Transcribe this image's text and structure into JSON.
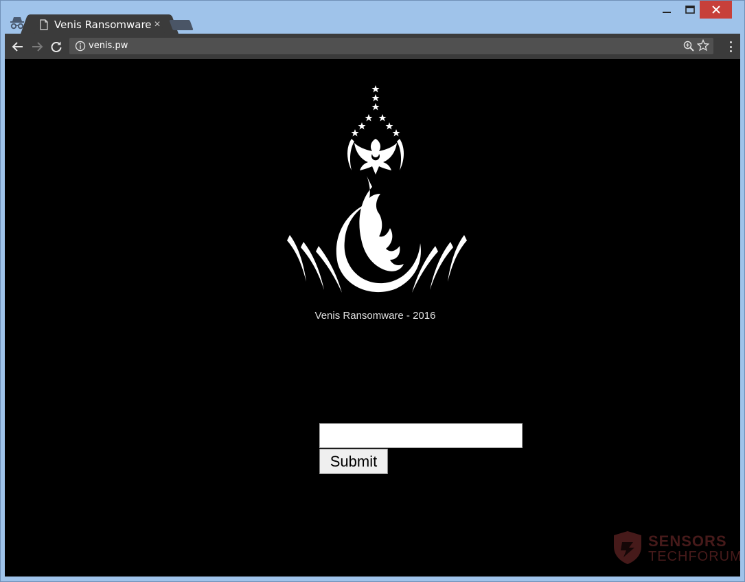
{
  "browser": {
    "tab_title": "Venis Ransomware",
    "tab_close": "×",
    "url": "venis.pw"
  },
  "icons": {
    "incognito": "incognito-icon",
    "page": "page-icon",
    "back": "back-arrow-icon",
    "forward": "forward-arrow-icon",
    "reload": "reload-icon",
    "info": "info-icon",
    "zoom": "zoom-icon",
    "bookmark": "star-icon",
    "menu": "kebab-menu-icon"
  },
  "page": {
    "caption": "Venis Ransomware - 2016",
    "input_value": "",
    "submit_label": "Submit"
  },
  "watermark": {
    "line1": "SENSORS",
    "line2": "TECHFORUM"
  },
  "colors": {
    "page_background": "#000000",
    "close_button": "#c7403a",
    "watermark": "#c94a4a"
  }
}
